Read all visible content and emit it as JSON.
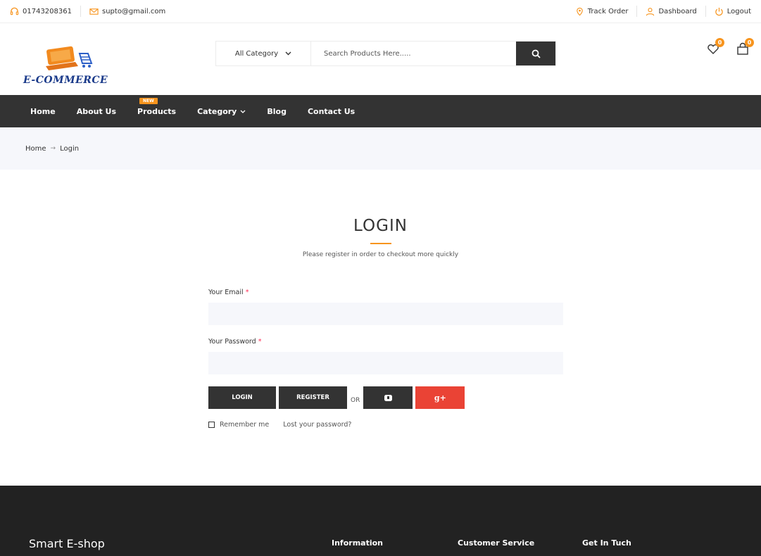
{
  "topbar": {
    "phone": "01743208361",
    "email": "supto@gmail.com",
    "track_order": "Track Order",
    "dashboard": "Dashboard",
    "logout": "Logout"
  },
  "header": {
    "logo_text": "E-COMMERCE",
    "search_category": "All Category",
    "search_placeholder": "Search Products Here.....",
    "wishlist_count": "0",
    "cart_count": "0"
  },
  "nav": {
    "items": [
      "Home",
      "About Us",
      "Products",
      "Category",
      "Blog",
      "Contact Us"
    ],
    "new_badge": "NEW"
  },
  "breadcrumb": {
    "home": "Home",
    "current": "Login"
  },
  "login": {
    "title": "LOGIN",
    "subtitle": "Please register in order to checkout more quickly",
    "email_label": "Your Email",
    "password_label": "Your Password",
    "required_mark": "*",
    "login_button": "LOGIN",
    "register_button": "REGISTER",
    "or_text": "OR",
    "google_button": "g+",
    "remember_me": "Remember me",
    "lost_password": "Lost your password?"
  },
  "footer": {
    "brand": "Smart E-shop",
    "col_information": "Information",
    "col_customer_service": "Customer Service",
    "col_get_in_touch": "Get In Tuch"
  },
  "colors": {
    "accent": "#f7941d",
    "dark": "#333333",
    "google": "#ea4335",
    "footer": "#222222",
    "light_bg": "#f6f7fb"
  }
}
